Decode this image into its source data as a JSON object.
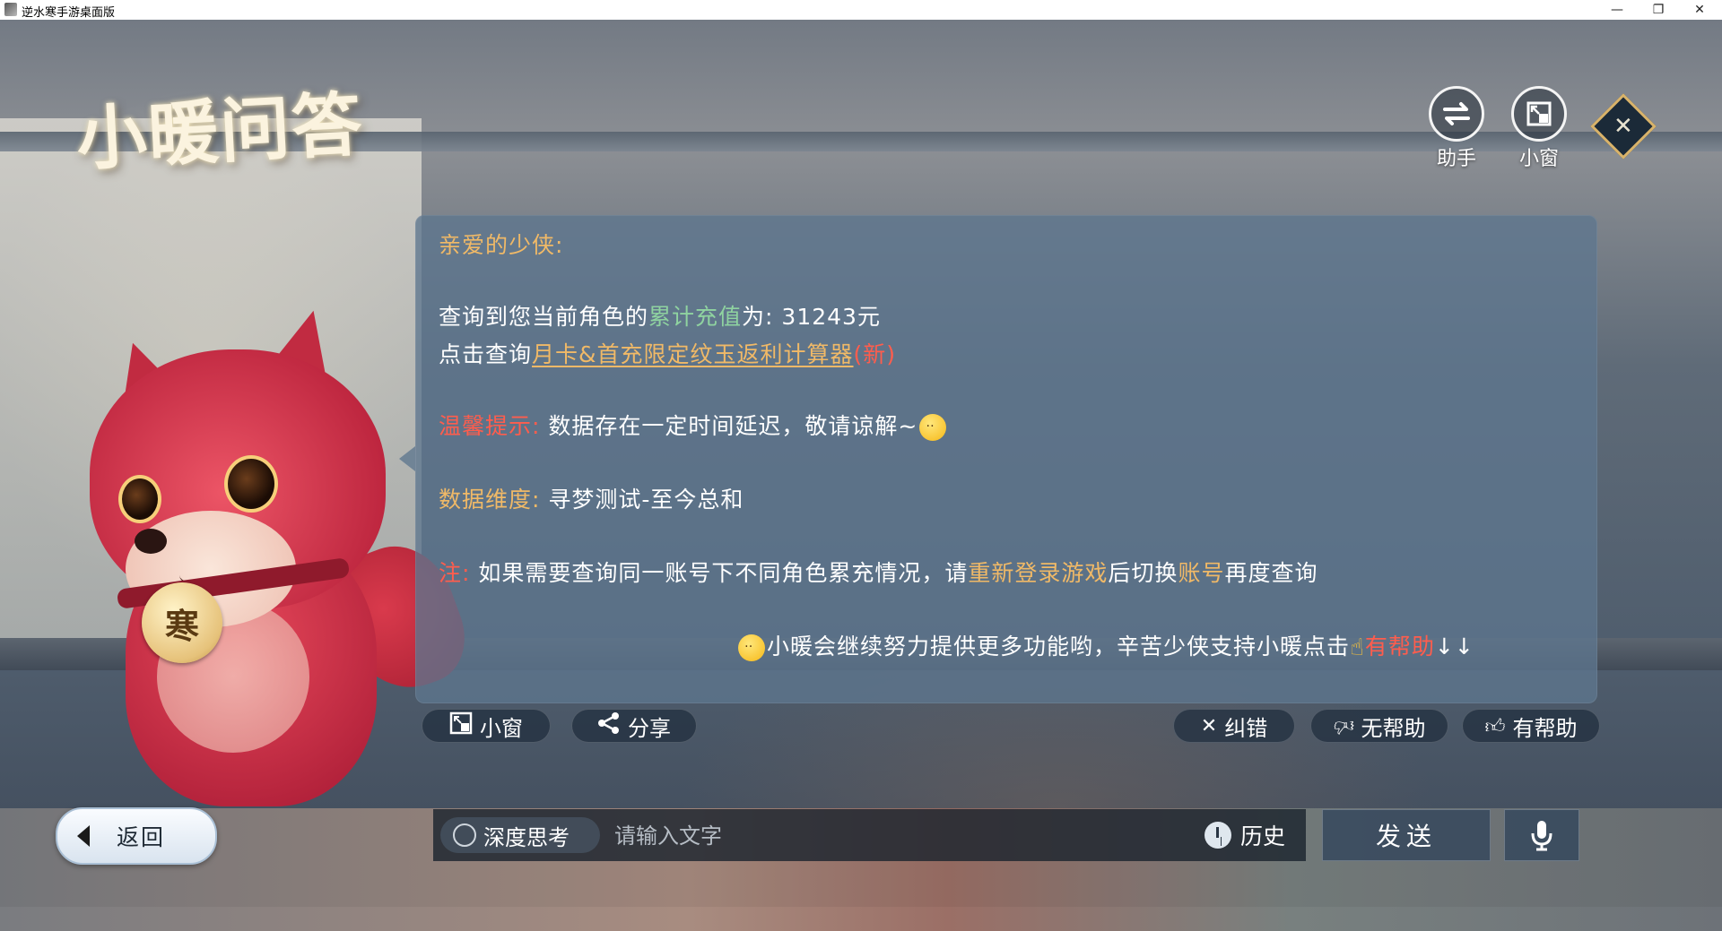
{
  "window": {
    "title": "逆水寒手游桌面版",
    "minimize_icon": "minimize-icon",
    "restore_icon": "restore-icon",
    "close_icon": "close-icon"
  },
  "header": {
    "page_title": "小暖问答",
    "buttons": [
      {
        "label": "助手",
        "icon": "swap-arrows-icon"
      },
      {
        "label": "小窗",
        "icon": "mini-window-icon"
      }
    ],
    "close_icon": "diamond-close-icon"
  },
  "mascot": {
    "tag_text": "寒"
  },
  "message": {
    "greeting": "亲爱的少侠:",
    "recharge": {
      "prefix": "查询到您当前角色的",
      "highlight": "累计充值",
      "middle": "为:",
      "value": "31243元"
    },
    "calculator": {
      "prefix": "点击查询",
      "link": "月卡&首充限定纹玉返利计算器",
      "badge": "(新)"
    },
    "tip": {
      "label": "温馨提示:",
      "text": "数据存在一定时间延迟，敬请谅解~"
    },
    "dimension": {
      "label": "数据维度:",
      "text": "寻梦测试-至今总和"
    },
    "note": {
      "label": "注:",
      "part1": "如果需要查询同一账号下不同角色累充情况，请",
      "highlight1": "重新登录游戏",
      "part2": "后切换",
      "highlight2": "账号",
      "part3": "再度查询"
    },
    "footer": {
      "text": "小暖会继续努力提供更多功能哟，辛苦少侠支持小暖点击",
      "helpful": "有帮助",
      "arrows": "↓↓"
    }
  },
  "panel_actions": {
    "mini_window": "小窗",
    "share": "分享",
    "correct": "纠错",
    "not_helpful": "无帮助",
    "helpful": "有帮助"
  },
  "bottom": {
    "back": "返回",
    "deep_think": "深度思考",
    "input_placeholder": "请输入文字",
    "history": "历史",
    "send": "发送",
    "mic_icon": "microphone-icon"
  },
  "colors": {
    "panel": "#5d768e",
    "orange": "#f0b967",
    "green": "#8fd3a0",
    "red": "#ff5d4d"
  }
}
